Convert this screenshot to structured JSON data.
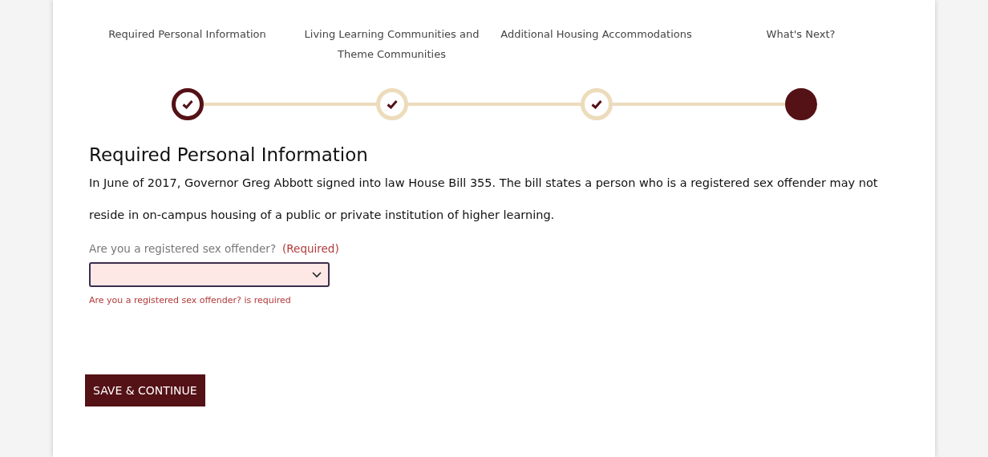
{
  "steps": [
    {
      "label": "Required Personal Information",
      "completed": true,
      "selected": true
    },
    {
      "label": "Living Learning Communities and Theme Communities",
      "completed": true,
      "selected": false
    },
    {
      "label": "Additional Housing Accommodations",
      "completed": true,
      "selected": false
    },
    {
      "label": "What's Next?",
      "completed": false,
      "selected": false
    }
  ],
  "heading": "Required Personal Information",
  "paragraph": "In June of 2017, Governor Greg Abbott signed into law House Bill 355. The bill states a person who is a registered sex offender may not reside in on-campus housing of a public or private institution of higher learning.",
  "question": {
    "label": "Are you a registered sex offender?",
    "required_tag": "(Required)",
    "invalid": true,
    "error": "Are you a registered sex offender? is required"
  },
  "button": "SAVE & CONTINUE"
}
